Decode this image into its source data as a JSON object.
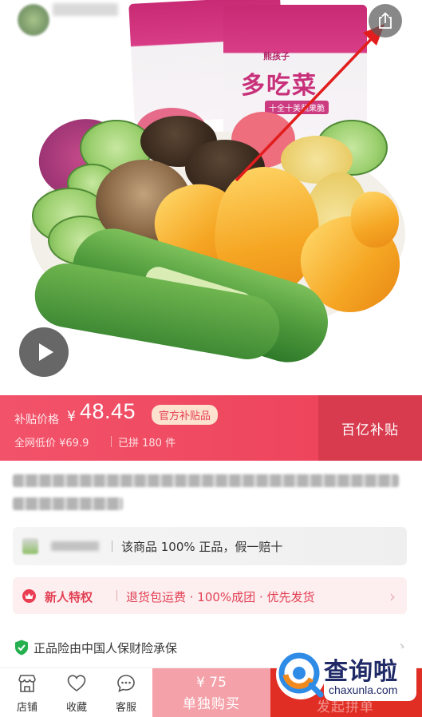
{
  "header": {
    "shop_name": "",
    "back_icon": "back-icon",
    "share_icon": "share-icon"
  },
  "hero": {
    "package_brand": "熊孩子",
    "package_title": "多吃菜",
    "package_sub": "十全十美蔬果脆",
    "play_icon": "play-icon"
  },
  "price_bar": {
    "label": "补贴价格",
    "currency": "¥",
    "price": "48.45",
    "badge": "官方补贴品",
    "market_label": "全网低价 ¥69.9",
    "sold_label": "已拼 180 件",
    "right_label": "百亿补贴",
    "colors": {
      "bar": "#ec4058",
      "right": "#d83a4e",
      "badge_bg": "#fde2cf"
    }
  },
  "guarantee": {
    "text": "该商品 100% 正品，假一赔十"
  },
  "new_user": {
    "title": "新人特权",
    "text": "退货包运费 · 100%成团 · 优先发货"
  },
  "insurance": {
    "text": "正品险由中国人保财险承保",
    "icon": "shield-check-icon"
  },
  "bottom_bar": {
    "items": [
      {
        "label": "店铺",
        "icon": "store-icon"
      },
      {
        "label": "收藏",
        "icon": "heart-icon"
      },
      {
        "label": "客服",
        "icon": "chat-icon"
      }
    ],
    "single_price": "¥ 75",
    "single_label": "单独购买",
    "group_label": "发起拼单",
    "colors": {
      "single": "#f4a1a9",
      "group": "#e02e24"
    }
  },
  "watermark": {
    "text": "查询啦",
    "url": "chaxunla.com"
  }
}
